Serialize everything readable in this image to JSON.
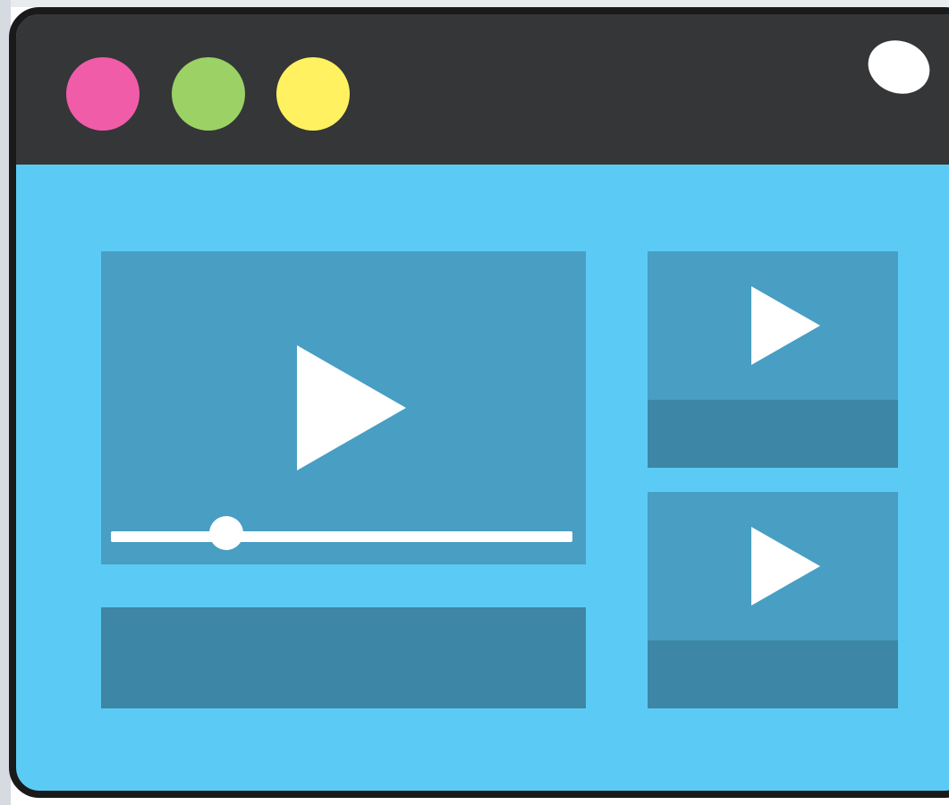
{
  "window": {
    "controls": [
      {
        "name": "close",
        "color": "#f05ca8"
      },
      {
        "name": "minimize",
        "color": "#9bd165"
      },
      {
        "name": "maximize",
        "color": "#fff15f"
      }
    ],
    "titlebar_color": "#343638",
    "background_color": "#5bcbf5"
  },
  "main_video": {
    "icon": "play-icon",
    "progress": 0.25
  },
  "side_videos": [
    {
      "icon": "play-icon"
    },
    {
      "icon": "play-icon"
    }
  ],
  "colors": {
    "panel": "#489ec3",
    "caption": "#3d86a6",
    "accent": "#ffffff"
  }
}
